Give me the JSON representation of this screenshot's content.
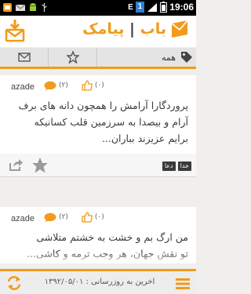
{
  "status_bar": {
    "time": "19:06",
    "notification_count": "1",
    "network_letter": "E"
  },
  "app": {
    "logo_name": "پیامک",
    "logo_sep": "|",
    "logo_suffix": "باب",
    "brand_color": "#f29b1a"
  },
  "toolbar": {
    "category_label": "همه"
  },
  "messages": [
    {
      "author": "azade",
      "likes": "(۰)",
      "comments": "(۲)",
      "lines": [
        "پروردگارا آرامش را همچون دانه های برف",
        "آرام و بیصدا به سرزمین قلب کسانیکه",
        "برایم عزیزند بباران..."
      ],
      "tags": [
        "دعا",
        "خدا"
      ]
    },
    {
      "author": "azade",
      "likes": "(۰)",
      "comments": "(۲)",
      "lines": [
        "من ارگ بم و خشت به خشتم متلاشی",
        "تو نقش جهان، هر وجب ترمه و کاشی..."
      ]
    }
  ],
  "footer": {
    "update_text": "اخرین به روزرسانی : ۱۳۹۲/۰۵/۰۱"
  }
}
